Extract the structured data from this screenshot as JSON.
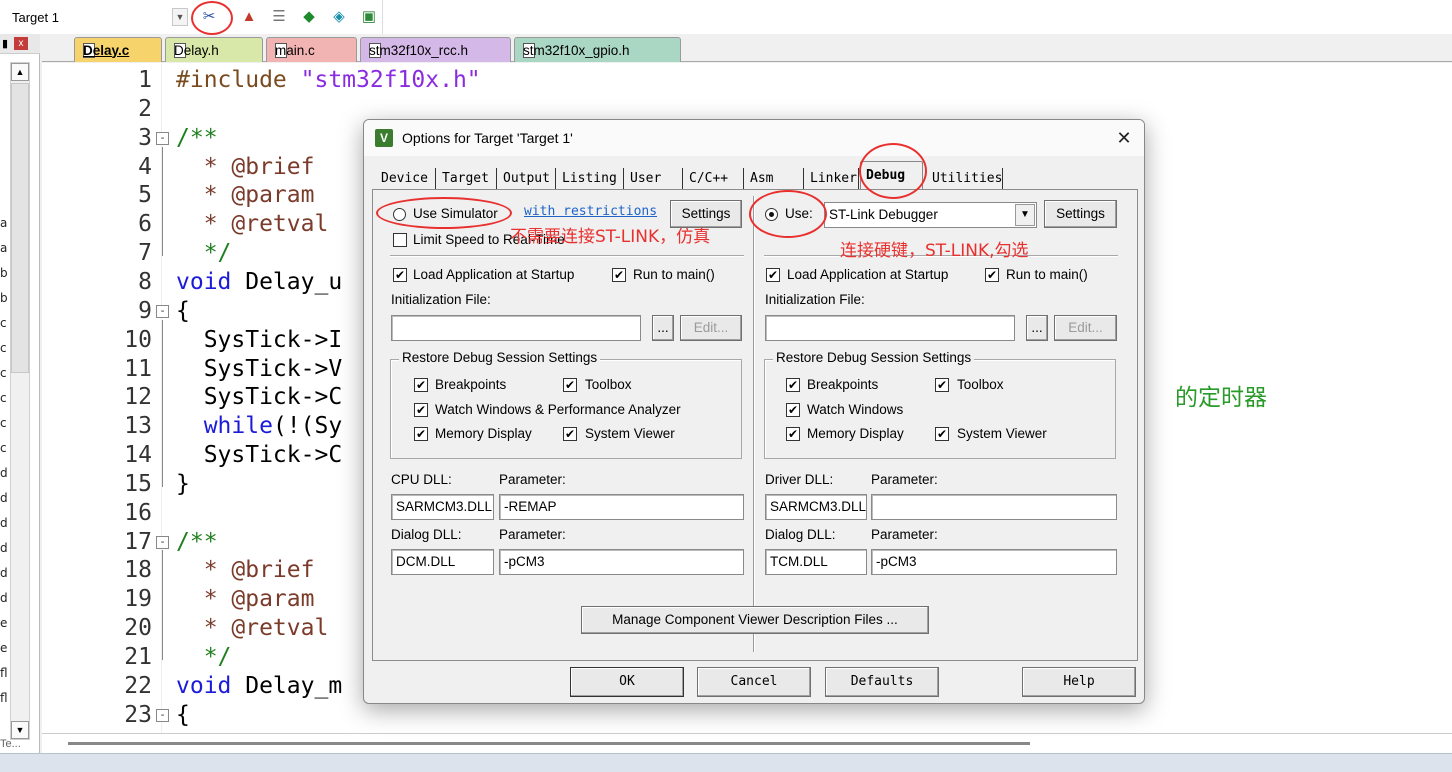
{
  "toolbar": {
    "target_name": "Target 1",
    "buttons": [
      "options-for-target",
      "manage-project-items",
      "select-packs",
      "pack-installer",
      "manage-run-time-environment",
      "select-software-packs"
    ]
  },
  "left_panel": {
    "fragments": [
      "a",
      "a",
      "b",
      "b",
      "c",
      "c",
      "c",
      "c",
      "c",
      "c",
      "d",
      "d",
      "d",
      "d",
      "d",
      "d",
      "e",
      "e",
      "fl",
      "fl"
    ],
    "bottom_label": "Te..."
  },
  "file_tabs": [
    {
      "label": "Delay.c",
      "active": true,
      "color": "#f7d36b"
    },
    {
      "label": "Delay.h",
      "active": false,
      "color": "#d7e8a8"
    },
    {
      "label": "main.c",
      "active": false,
      "color": "#f2b3b3"
    },
    {
      "label": "stm32f10x_rcc.h",
      "active": false,
      "color": "#d4b8e8"
    },
    {
      "label": "stm32f10x_gpio.h",
      "active": false,
      "color": "#a9d7c4"
    }
  ],
  "code": {
    "line_numbers": [
      "1",
      "2",
      "3",
      "4",
      "5",
      "6",
      "7",
      "8",
      "9",
      "10",
      "11",
      "12",
      "13",
      "14",
      "15",
      "16",
      "17",
      "18",
      "19",
      "20",
      "21",
      "22",
      "23"
    ],
    "lines": [
      {
        "parts": [
          {
            "t": "#include ",
            "c": "pp"
          },
          {
            "t": "\"stm32f10x.h\"",
            "c": "str"
          }
        ]
      },
      {
        "parts": []
      },
      {
        "parts": [
          {
            "t": "/**",
            "c": "cmt"
          }
        ]
      },
      {
        "parts": [
          {
            "t": "  * @brief",
            "c": "doc"
          }
        ]
      },
      {
        "parts": [
          {
            "t": "  * @param",
            "c": "doc"
          }
        ]
      },
      {
        "parts": [
          {
            "t": "  * @retval",
            "c": "doc"
          }
        ]
      },
      {
        "parts": [
          {
            "t": "  */",
            "c": "cmt"
          }
        ]
      },
      {
        "parts": [
          {
            "t": "void",
            "c": "kw"
          },
          {
            "t": " Delay_u",
            "c": ""
          }
        ]
      },
      {
        "parts": [
          {
            "t": "{",
            "c": ""
          }
        ]
      },
      {
        "parts": [
          {
            "t": "  SysTick->I",
            "c": ""
          }
        ]
      },
      {
        "parts": [
          {
            "t": "  SysTick->V",
            "c": ""
          }
        ]
      },
      {
        "parts": [
          {
            "t": "  SysTick->C",
            "c": ""
          }
        ]
      },
      {
        "parts": [
          {
            "t": "  ",
            "c": ""
          },
          {
            "t": "while",
            "c": "kw"
          },
          {
            "t": "(!(Sy",
            "c": ""
          }
        ]
      },
      {
        "parts": [
          {
            "t": "  SysTick->C",
            "c": ""
          }
        ]
      },
      {
        "parts": [
          {
            "t": "}",
            "c": ""
          }
        ]
      },
      {
        "parts": []
      },
      {
        "parts": [
          {
            "t": "/**",
            "c": "cmt"
          }
        ]
      },
      {
        "parts": [
          {
            "t": "  * @brief",
            "c": "doc"
          }
        ]
      },
      {
        "parts": [
          {
            "t": "  * @param",
            "c": "doc"
          }
        ]
      },
      {
        "parts": [
          {
            "t": "  * @retval",
            "c": "doc"
          }
        ]
      },
      {
        "parts": [
          {
            "t": "  */",
            "c": "cmt"
          }
        ]
      },
      {
        "parts": [
          {
            "t": "void",
            "c": "kw"
          },
          {
            "t": " Delay_m",
            "c": ""
          }
        ]
      },
      {
        "parts": [
          {
            "t": "{",
            "c": ""
          }
        ]
      }
    ],
    "fold_markers": {
      "3": "-",
      "9": "-",
      "17": "-",
      "23": "-"
    },
    "background_comment": "的定时器"
  },
  "dialog": {
    "title": "Options for Target 'Target 1'",
    "close_glyph": "✕",
    "tabs": [
      "Device",
      "Target",
      "Output",
      "Listing",
      "User",
      "C/C++",
      "Asm",
      "Linker",
      "Debug",
      "Utilities"
    ],
    "active_tab": "Debug",
    "left": {
      "use_simulator": "Use Simulator",
      "simulator_selected": false,
      "restrictions_link": "with restrictions",
      "settings": "Settings",
      "limit_speed": "Limit Speed to Real-Time",
      "load_app": "Load Application at Startup",
      "run_to_main": "Run to main()",
      "init_file_label": "Initialization File:",
      "init_file_value": "",
      "browse": "...",
      "edit": "Edit...",
      "restore_title": "Restore Debug Session Settings",
      "breakpoints": "Breakpoints",
      "toolbox": "Toolbox",
      "watch_windows": "Watch Windows & Performance Analyzer",
      "memory_display": "Memory Display",
      "system_viewer": "System Viewer",
      "dll_label": "CPU DLL:",
      "param_label": "Parameter:",
      "dll_value": "SARMCM3.DLL",
      "param_value": "-REMAP",
      "dialog_dll_label": "Dialog DLL:",
      "dialog_param_label": "Parameter:",
      "dialog_dll_value": "DCM.DLL",
      "dialog_param_value": "-pCM3"
    },
    "right": {
      "use": "Use:",
      "use_selected": true,
      "debugger": "ST-Link Debugger",
      "settings": "Settings",
      "load_app": "Load Application at Startup",
      "run_to_main": "Run to main()",
      "init_file_label": "Initialization File:",
      "init_file_value": "",
      "browse": "...",
      "edit": "Edit...",
      "restore_title": "Restore Debug Session Settings",
      "breakpoints": "Breakpoints",
      "toolbox": "Toolbox",
      "watch_windows": "Watch Windows",
      "memory_display": "Memory Display",
      "system_viewer": "System Viewer",
      "dll_label": "Driver DLL:",
      "param_label": "Parameter:",
      "dll_value": "SARMCM3.DLL",
      "param_value": "",
      "dialog_dll_label": "Dialog DLL:",
      "dialog_param_label": "Parameter:",
      "dialog_dll_value": "TCM.DLL",
      "dialog_param_value": "-pCM3"
    },
    "manage_button": "Manage Component Viewer Description Files ...",
    "buttons": {
      "ok": "OK",
      "cancel": "Cancel",
      "defaults": "Defaults",
      "help": "Help"
    }
  },
  "annotations": {
    "left_note": "不需要连接ST-LINK，仿真",
    "right_note": "连接硬键，ST-LINK,勾选",
    "color": "#e8312f"
  }
}
